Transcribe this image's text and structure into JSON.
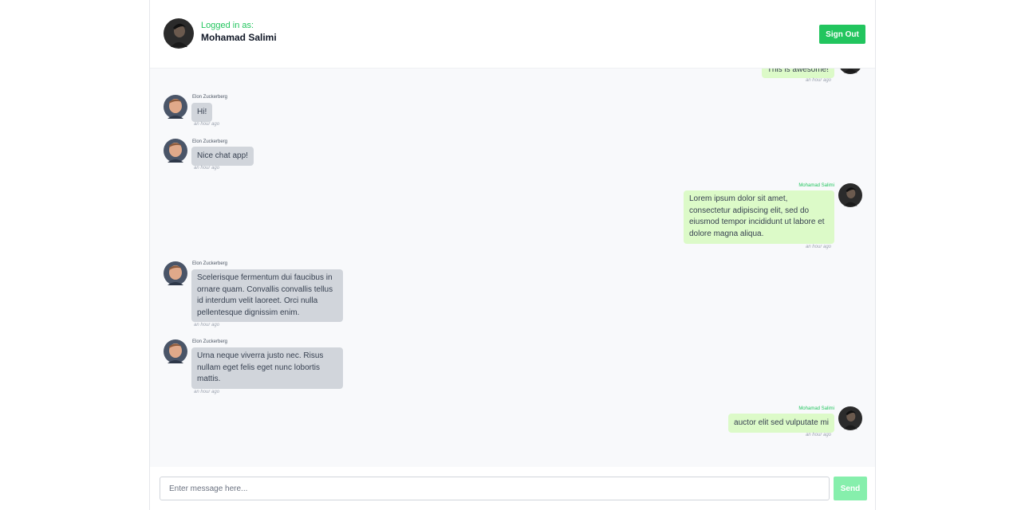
{
  "header": {
    "logged_label": "Logged in as:",
    "user_name": "Mohamad Salimi",
    "signout_label": "Sign Out"
  },
  "messages": [
    {
      "direction": "out",
      "author": "",
      "text": "This is awesome!",
      "time": "an hour ago"
    },
    {
      "direction": "in",
      "author": "Elon Zuckerberg",
      "text": "Hi!",
      "time": "an hour ago"
    },
    {
      "direction": "in",
      "author": "Elon Zuckerberg",
      "text": "Nice chat app!",
      "time": "an hour ago"
    },
    {
      "direction": "out",
      "author": "Mohamad Salimi",
      "text": "Lorem ipsum dolor sit amet, consectetur adipiscing elit, sed do eiusmod tempor incididunt ut labore et dolore magna aliqua.",
      "time": "an hour ago"
    },
    {
      "direction": "in",
      "author": "Elon Zuckerberg",
      "text": "Scelerisque fermentum dui faucibus in ornare quam. Convallis convallis tellus id interdum velit laoreet. Orci nulla pellentesque dignissim enim.",
      "time": "an hour ago"
    },
    {
      "direction": "in",
      "author": "Elon Zuckerberg",
      "text": "Urna neque viverra justo nec. Risus nullam eget felis eget nunc lobortis mattis.",
      "time": "an hour ago"
    },
    {
      "direction": "out",
      "author": "Mohamad Salimi",
      "text": "auctor elit sed vulputate mi",
      "time": "an hour ago"
    }
  ],
  "composer": {
    "placeholder": "Enter message here...",
    "send_label": "Send"
  },
  "colors": {
    "accent": "#22c55e",
    "outgoing_bubble": "#dcfac8",
    "incoming_bubble": "#d1d5db"
  }
}
